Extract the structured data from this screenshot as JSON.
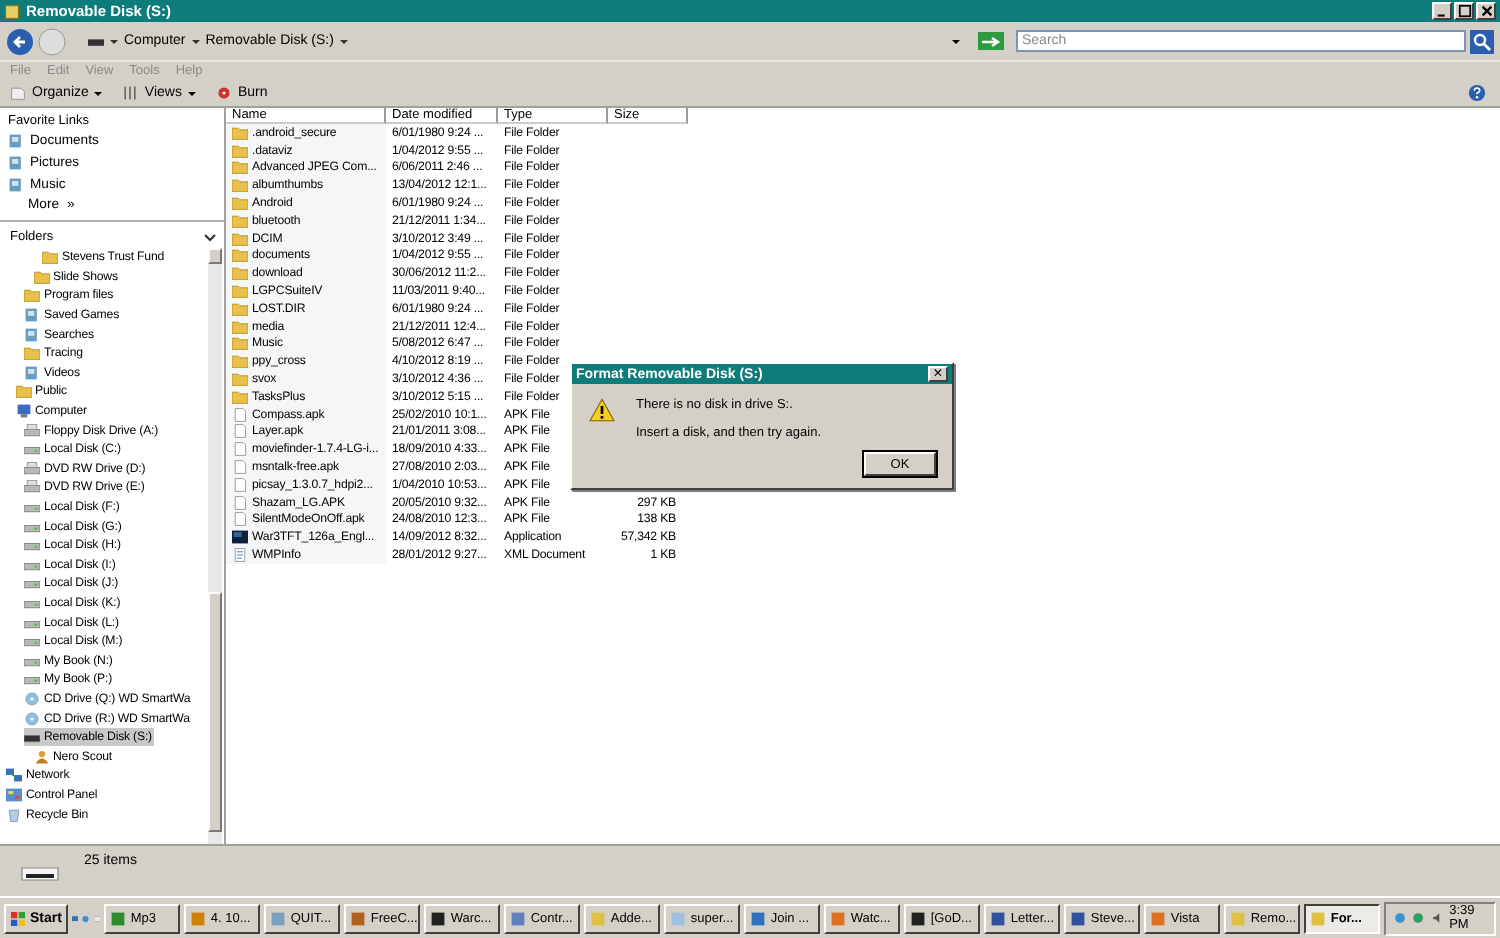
{
  "window": {
    "title": "Removable Disk (S:)"
  },
  "address": {
    "crumbs": [
      "Computer",
      "Removable Disk (S:)"
    ]
  },
  "search": {
    "placeholder": "Search"
  },
  "menu": [
    "File",
    "Edit",
    "View",
    "Tools",
    "Help"
  ],
  "toolbar": [
    {
      "label": "Organize",
      "kind": "organize"
    },
    {
      "label": "Views",
      "kind": "views"
    },
    {
      "label": "Burn",
      "kind": "burn"
    }
  ],
  "favorites": {
    "title": "Favorite Links",
    "items": [
      {
        "label": "Documents"
      },
      {
        "label": "Pictures"
      },
      {
        "label": "Music"
      }
    ],
    "more": "More",
    "more_glyph": "»"
  },
  "folders": {
    "title": "Folders",
    "tree": [
      {
        "children": [
          {
            "children": [
              {
                "children": [
                  {
                    "children": [
                      {
                        "label": "Stevens Trust Fund",
                        "kind": "folder",
                        "selected": false
                      }
                    ]
                  },
                  {
                    "label": "Slide Shows",
                    "kind": "folder",
                    "selected": false
                  }
                ]
              },
              {
                "label": "Program files",
                "kind": "folder",
                "selected": false
              },
              {
                "label": "Saved Games",
                "kind": "library",
                "selected": false
              },
              {
                "label": "Searches",
                "kind": "library",
                "selected": false
              },
              {
                "label": "Tracing",
                "kind": "folder",
                "selected": false
              },
              {
                "label": "Videos",
                "kind": "library",
                "selected": false
              }
            ]
          },
          {
            "label": "Public",
            "kind": "folder",
            "selected": false
          },
          {
            "label": "Computer",
            "kind": "computer",
            "selected": false,
            "children": [
              {
                "label": "Floppy Disk Drive (A:)",
                "kind": "floppy",
                "selected": false
              },
              {
                "label": "Local Disk (C:)",
                "kind": "disk",
                "selected": false
              },
              {
                "label": "DVD RW Drive (D:)",
                "kind": "dvd",
                "selected": false
              },
              {
                "label": "DVD RW Drive (E:)",
                "kind": "dvd",
                "selected": false
              },
              {
                "label": "Local Disk (F:)",
                "kind": "disk",
                "selected": false
              },
              {
                "label": "Local Disk (G:)",
                "kind": "disk",
                "selected": false
              },
              {
                "label": "Local Disk (H:)",
                "kind": "disk",
                "selected": false
              },
              {
                "label": "Local Disk (I:)",
                "kind": "disk",
                "selected": false
              },
              {
                "label": "Local Disk (J:)",
                "kind": "disk",
                "selected": false
              },
              {
                "label": "Local Disk (K:)",
                "kind": "disk",
                "selected": false
              },
              {
                "label": "Local Disk (L:)",
                "kind": "disk",
                "selected": false
              },
              {
                "label": "Local Disk (M:)",
                "kind": "disk",
                "selected": false
              },
              {
                "label": "My Book (N:)",
                "kind": "disk",
                "selected": false
              },
              {
                "label": "My Book (P:)",
                "kind": "disk",
                "selected": false
              },
              {
                "label": "CD Drive (Q:) WD SmartWa",
                "kind": "cd",
                "selected": false
              },
              {
                "label": "CD Drive (R:) WD SmartWa",
                "kind": "cd",
                "selected": false
              },
              {
                "label": "Removable Disk (S:)",
                "kind": "removable",
                "selected": true,
                "children": [
                  {
                    "label": "Nero Scout",
                    "kind": "nero",
                    "selected": false
                  }
                ]
              }
            ]
          }
        ]
      },
      {
        "label": "Network",
        "kind": "network",
        "selected": false
      },
      {
        "label": "Control Panel",
        "kind": "panel",
        "selected": false
      },
      {
        "label": "Recycle Bin",
        "kind": "bin",
        "selected": false
      }
    ]
  },
  "table": {
    "columns": [
      "Name",
      "Date modified",
      "Type",
      "Size"
    ],
    "rows": [
      {
        "name": ".android_secure",
        "date": "6/01/1980 9:24 ...",
        "type": "File Folder",
        "kind": "folder"
      },
      {
        "name": ".dataviz",
        "date": "1/04/2012 9:55 ...",
        "type": "File Folder",
        "kind": "folder"
      },
      {
        "name": "Advanced JPEG Com...",
        "date": "6/06/2011 2:46 ...",
        "type": "File Folder",
        "kind": "folder"
      },
      {
        "name": "albumthumbs",
        "date": "13/04/2012 12:1...",
        "type": "File Folder",
        "kind": "folder"
      },
      {
        "name": "Android",
        "date": "6/01/1980 9:24 ...",
        "type": "File Folder",
        "kind": "folder"
      },
      {
        "name": "bluetooth",
        "date": "21/12/2011 1:34...",
        "type": "File Folder",
        "kind": "folder"
      },
      {
        "name": "DCIM",
        "date": "3/10/2012 3:49 ...",
        "type": "File Folder",
        "kind": "folder"
      },
      {
        "name": "documents",
        "date": "1/04/2012 9:55 ...",
        "type": "File Folder",
        "kind": "folder"
      },
      {
        "name": "download",
        "date": "30/06/2012 11:2...",
        "type": "File Folder",
        "kind": "folder"
      },
      {
        "name": "LGPCSuiteIV",
        "date": "11/03/2011 9:40...",
        "type": "File Folder",
        "kind": "folder"
      },
      {
        "name": "LOST.DIR",
        "date": "6/01/1980 9:24 ...",
        "type": "File Folder",
        "kind": "folder"
      },
      {
        "name": "media",
        "date": "21/12/2011 12:4...",
        "type": "File Folder",
        "kind": "folder"
      },
      {
        "name": "Music",
        "date": "5/08/2012 6:47 ...",
        "type": "File Folder",
        "kind": "folder"
      },
      {
        "name": "ppy_cross",
        "date": "4/10/2012 8:19 ...",
        "type": "File Folder",
        "kind": "folder"
      },
      {
        "name": "svox",
        "date": "3/10/2012 4:36 ...",
        "type": "File Folder",
        "kind": "folder"
      },
      {
        "name": "TasksPlus",
        "date": "3/10/2012 5:15 ...",
        "type": "File Folder",
        "kind": "folder"
      },
      {
        "name": "Compass.apk",
        "date": "25/02/2010 10:1...",
        "type": "APK File",
        "kind": "file"
      },
      {
        "name": "Layer.apk",
        "date": "21/01/2011 3:08...",
        "type": "APK File",
        "kind": "file"
      },
      {
        "name": "moviefinder-1.7.4-LG-i...",
        "date": "18/09/2010 4:33...",
        "type": "APK File",
        "kind": "file"
      },
      {
        "name": "msntalk-free.apk",
        "date": "27/08/2010 2:03...",
        "type": "APK File",
        "kind": "file"
      },
      {
        "name": "picsay_1.3.0.7_hdpi2...",
        "date": "1/04/2010 10:53...",
        "type": "APK File",
        "kind": "file"
      },
      {
        "name": "Shazam_LG.APK",
        "date": "20/05/2010 9:32...",
        "type": "APK File",
        "size": "297 KB",
        "kind": "file"
      },
      {
        "name": "SilentModeOnOff.apk",
        "date": "24/08/2010 12:3...",
        "type": "APK File",
        "size": "138 KB",
        "kind": "file"
      },
      {
        "name": "War3TFT_126a_Engl...",
        "date": "14/09/2012 8:32...",
        "type": "Application",
        "size": "57,342 KB",
        "kind": "app"
      },
      {
        "name": "WMPInfo",
        "date": "28/01/2012 9:27...",
        "type": "XML Document",
        "size": "1 KB",
        "kind": "doc"
      }
    ]
  },
  "dialog": {
    "title": "Format Removable Disk (S:)",
    "close": "×",
    "message": "There is no disk in drive S:.",
    "hint": "Insert a disk, and then try again.",
    "button": "OK"
  },
  "details": {
    "text": "25 items"
  },
  "taskbar": {
    "start": "Start",
    "tasks": [
      {
        "label": "Mp3",
        "selected": false
      },
      {
        "label": "4. 10...",
        "selected": false
      },
      {
        "label": "QUIT...",
        "selected": false
      },
      {
        "label": "FreeC...",
        "selected": false
      },
      {
        "label": "Warc...",
        "selected": false
      },
      {
        "label": "Contr...",
        "selected": false
      },
      {
        "label": "Adde...",
        "selected": false
      },
      {
        "label": "super...",
        "selected": false
      },
      {
        "label": "Join ...",
        "selected": false
      },
      {
        "label": "Watc...",
        "selected": false
      },
      {
        "label": "[GoD...",
        "selected": false
      },
      {
        "label": "Letter...",
        "selected": false
      },
      {
        "label": "Steve...",
        "selected": false
      },
      {
        "label": "Vista",
        "selected": false
      },
      {
        "label": "Remo...",
        "selected": false
      },
      {
        "label": "For...",
        "selected": true
      }
    ],
    "clock": "3:39 PM"
  }
}
